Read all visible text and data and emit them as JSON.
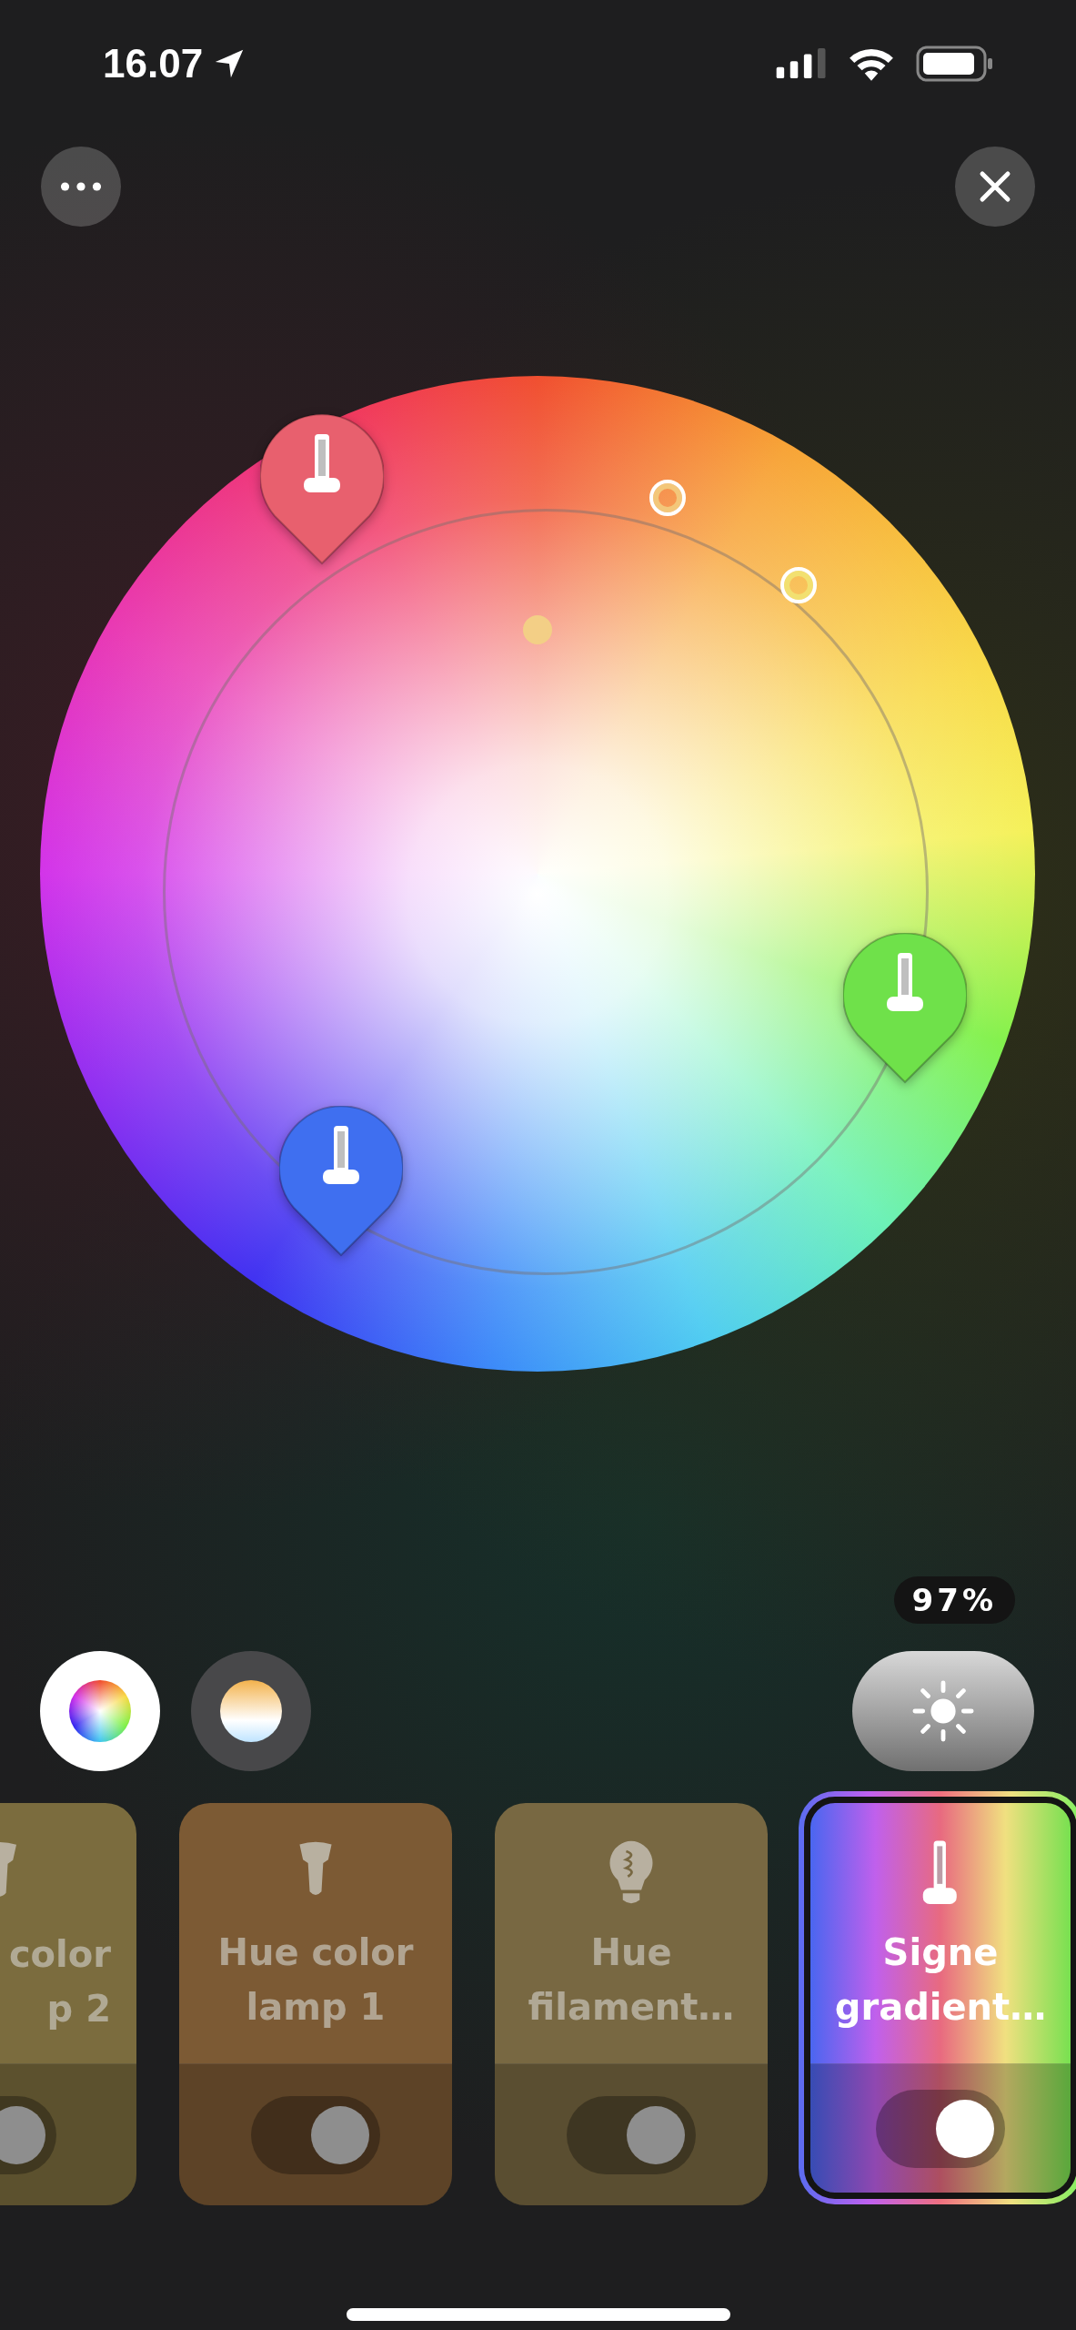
{
  "status_bar": {
    "time": "16.07"
  },
  "wheel": {
    "markers": [
      {
        "kind": "pin",
        "color": "#e8606e"
      },
      {
        "kind": "ring-point",
        "color": "#f3c77a"
      },
      {
        "kind": "ring-point",
        "color": "#f2e070"
      },
      {
        "kind": "dot",
        "color": "#f3cf86"
      },
      {
        "kind": "pin",
        "color": "#3f6ff0"
      },
      {
        "kind": "pin",
        "color": "#6fe14a"
      }
    ]
  },
  "modes": [
    {
      "kind": "color",
      "selected": true
    },
    {
      "kind": "white",
      "selected": false
    }
  ],
  "brightness": {
    "reading": "97%"
  },
  "lamps": [
    {
      "kind": "bulb",
      "lines": [
        "color",
        "p 2"
      ],
      "cut": true,
      "selected": false,
      "on": true,
      "color": "#7b6c3e"
    },
    {
      "kind": "bulb",
      "lines": [
        "Hue color",
        "lamp 1"
      ],
      "cut": false,
      "selected": false,
      "on": true,
      "color": "#7c5a34"
    },
    {
      "kind": "filament",
      "lines": [
        "Hue",
        "filament…"
      ],
      "cut": false,
      "selected": false,
      "on": true,
      "color": "#786842"
    },
    {
      "kind": "gradient",
      "lines": [
        "Signe",
        "gradient…"
      ],
      "cut": false,
      "selected": true,
      "on": true
    }
  ]
}
